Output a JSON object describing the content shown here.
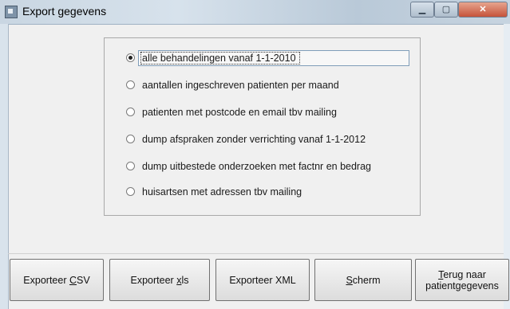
{
  "window": {
    "title": "Export gegevens",
    "controls": {
      "minimize": "▁",
      "maximize": "▢",
      "close": "✕"
    }
  },
  "options": [
    {
      "label": "alle behandelingen vanaf 1-1-2010",
      "selected": true
    },
    {
      "label": "aantallen ingeschreven patienten per maand",
      "selected": false
    },
    {
      "label": "patienten met postcode en email tbv mailing",
      "selected": false
    },
    {
      "label": "dump afspraken zonder verrichting vanaf 1-1-2012",
      "selected": false
    },
    {
      "label": "dump uitbestede onderzoeken met factnr en bedrag",
      "selected": false
    },
    {
      "label": "huisartsen met adressen tbv mailing",
      "selected": false
    }
  ],
  "buttons": {
    "csv": {
      "pre": "Exporteer ",
      "mn": "C",
      "post": "SV"
    },
    "xls": {
      "pre": "Exporteer ",
      "mn": "x",
      "post": "ls"
    },
    "xml": {
      "pre": "Exporteer XML",
      "mn": "",
      "post": ""
    },
    "scherm": {
      "pre": "",
      "mn": "S",
      "post": "cherm"
    },
    "terug": {
      "line1_mn": "T",
      "line1_post": "erug naar",
      "line2": "patientgegevens"
    }
  },
  "icons": {
    "window": "app-window-icon",
    "radio_checked": "radio-checked",
    "radio_unchecked": "radio-unchecked"
  }
}
